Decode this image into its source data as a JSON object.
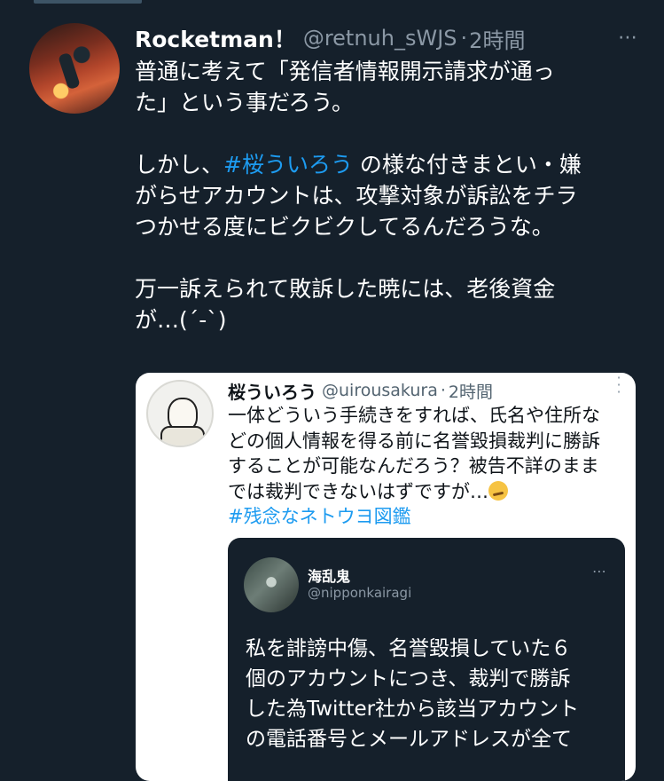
{
  "tweet": {
    "display_name": "Rocketman！",
    "handle": "@retnuh_sWJS",
    "separator": "·",
    "time": "2時間",
    "more_icon": "⋯",
    "text": {
      "line1": "普通に考えて「発信者情報開示請求が通っ",
      "line2": "た」という事だろう。",
      "line3_pre": "しかし、",
      "line3_hashtag": "#桜ういろう",
      "line3_post": " の様な付きまとい・嫌",
      "line4": "がらせアカウントは、攻撃対象が訴訟をチラ",
      "line5": "つかせる度にビクビクしてるんだろうな。",
      "line6": "万一訴えられて敗訴した暁には、老後資金",
      "line7": "が…(´-`)"
    }
  },
  "quoted_tweet": {
    "display_name": "桜ういろう",
    "handle": "@uirousakura",
    "separator": "·",
    "time": "2時間",
    "more_icon": "⋮",
    "text": {
      "line1": "一体どういう手続きをすれば、氏名や住所な",
      "line2": "どの個人情報を得る前に名誉毀損裁判に勝訴",
      "line3": "することが可能なんだろう？被告不詳のまま",
      "line4": "では裁判できないはずですが…",
      "hashtag": "#残念なネトウヨ図鑑"
    },
    "embedded_tweet": {
      "display_name": "海乱鬼",
      "handle": "@nipponkairagi",
      "more_icon": "⋯",
      "text": {
        "line1": "私を誹謗中傷、名誉毀損していた６",
        "line2": "個のアカウントにつき、裁判で勝訴",
        "line3": "した為Twitter社から該当アカウント",
        "line4": "の電話番号とメールアドレスが全て"
      }
    }
  },
  "colors": {
    "background": "#15202b",
    "accent": "#1d9bf0",
    "secondary_text": "#8b98a5"
  }
}
